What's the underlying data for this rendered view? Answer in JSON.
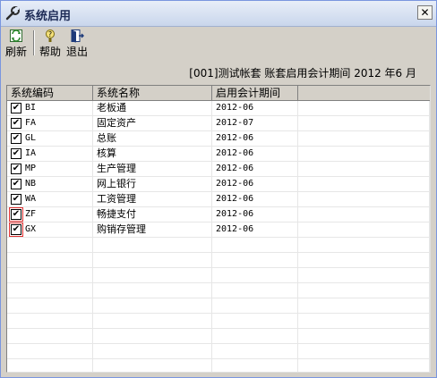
{
  "window": {
    "title": "系统启用"
  },
  "toolbar": {
    "refresh_label": "刷新",
    "help_label": "帮助",
    "exit_label": "退出"
  },
  "info": {
    "text": "[001]测试帐套 账套启用会计期间 2012 年6 月"
  },
  "table": {
    "headers": [
      "系统编码",
      "系统名称",
      "启用会计期间"
    ],
    "rows": [
      {
        "checked": true,
        "code": "BI",
        "name": "老板通",
        "period": "2012-06"
      },
      {
        "checked": true,
        "code": "FA",
        "name": "固定资产",
        "period": "2012-07"
      },
      {
        "checked": true,
        "code": "GL",
        "name": "总账",
        "period": "2012-06"
      },
      {
        "checked": true,
        "code": "IA",
        "name": "核算",
        "period": "2012-06"
      },
      {
        "checked": true,
        "code": "MP",
        "name": "生产管理",
        "period": "2012-06"
      },
      {
        "checked": true,
        "code": "NB",
        "name": "网上银行",
        "period": "2012-06"
      },
      {
        "checked": true,
        "code": "WA",
        "name": "工资管理",
        "period": "2012-06"
      },
      {
        "checked": true,
        "code": "ZF",
        "name": "畅捷支付",
        "period": "2012-06"
      },
      {
        "checked": true,
        "code": "GX",
        "name": "购销存管理",
        "period": "2012-06"
      }
    ]
  }
}
